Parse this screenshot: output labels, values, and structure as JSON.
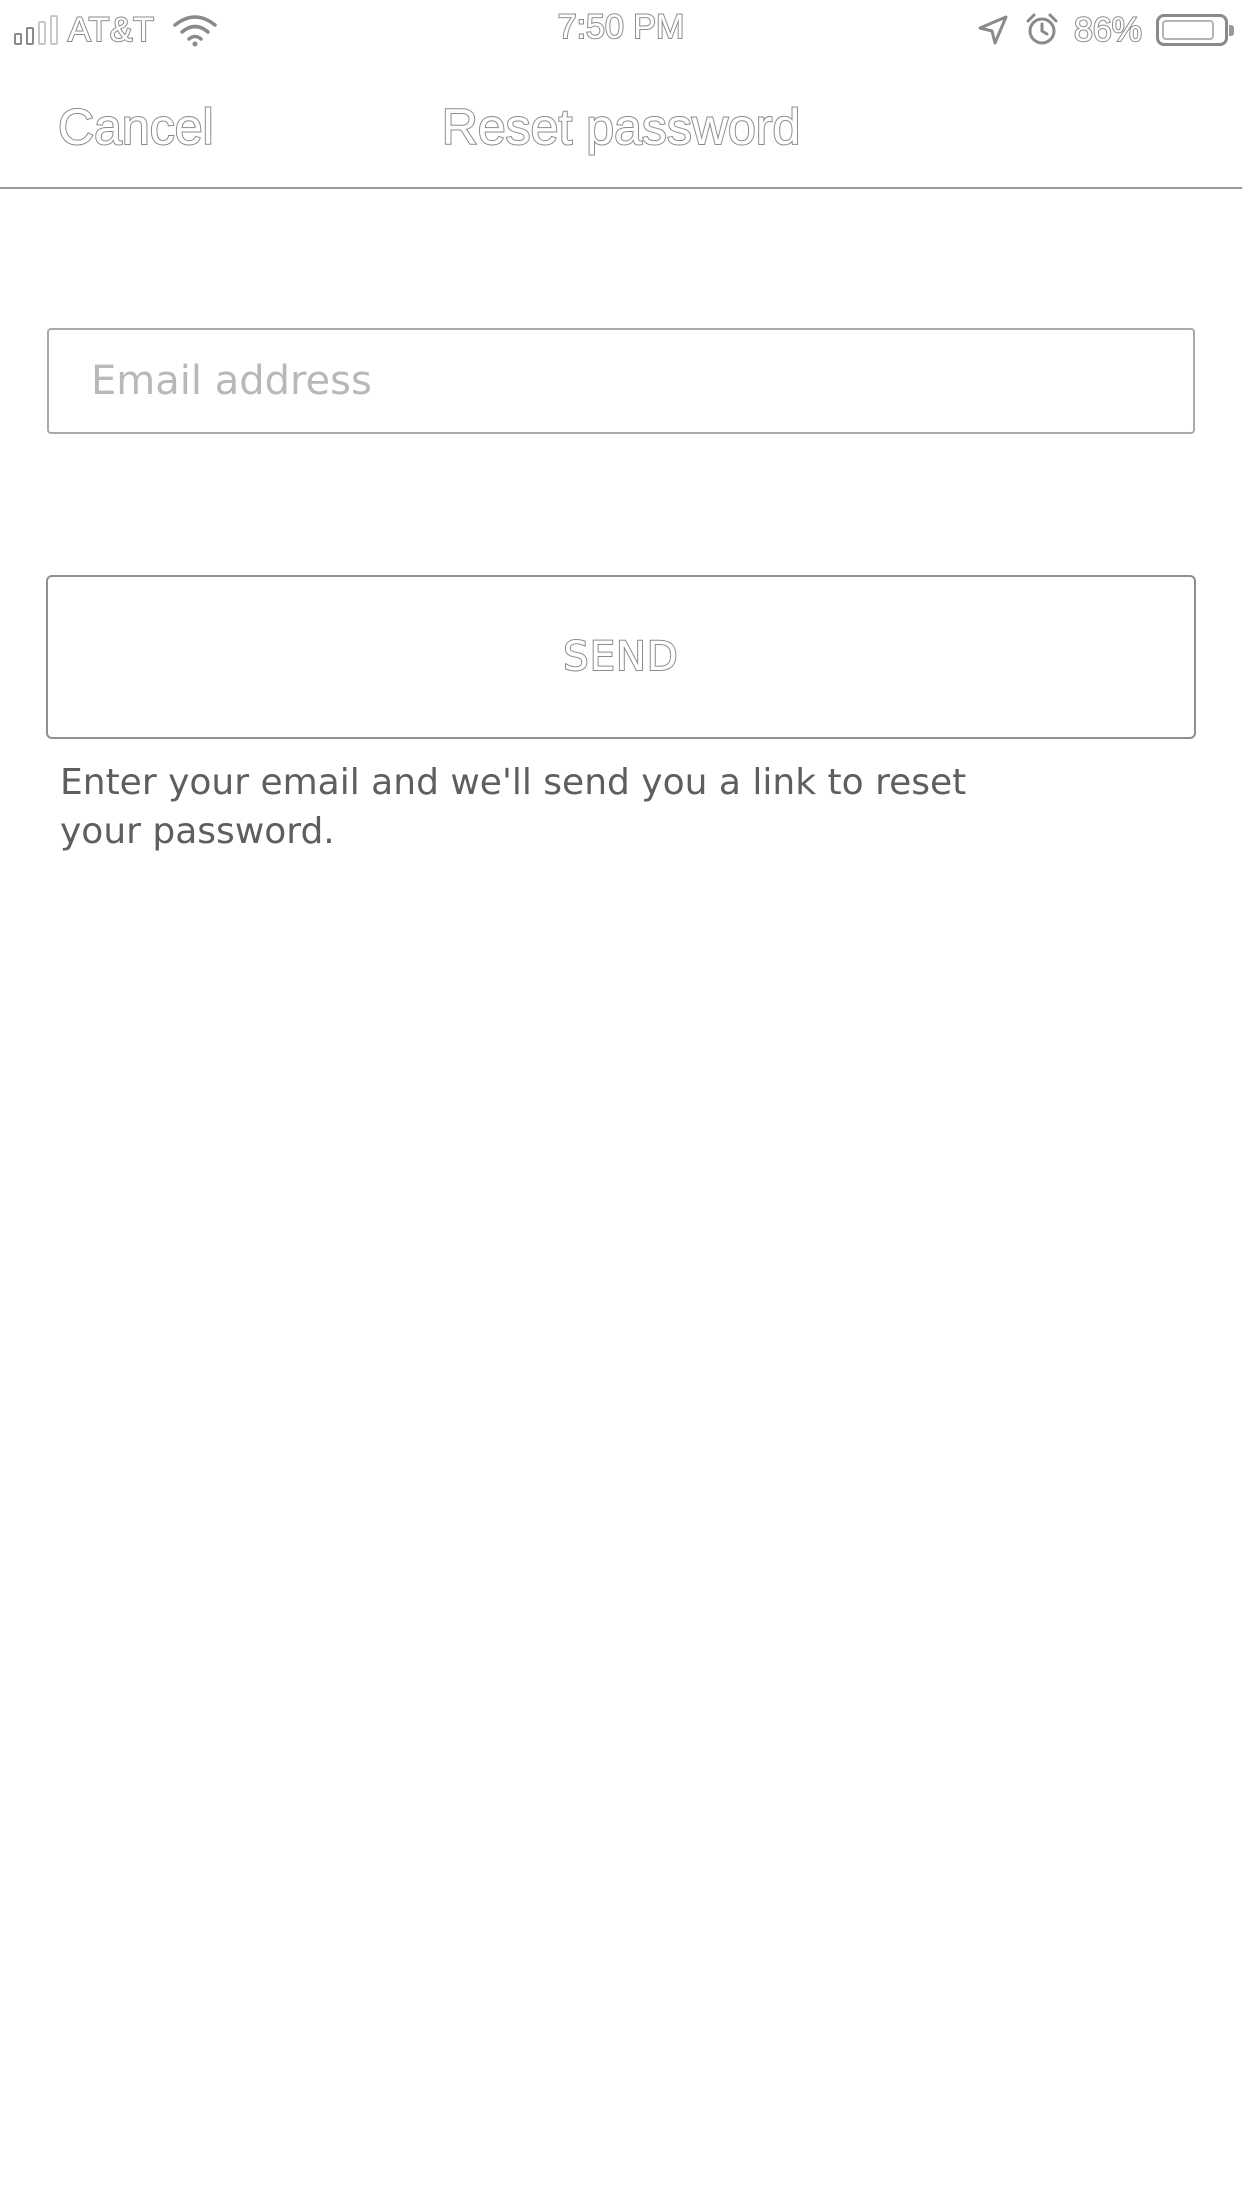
{
  "status_bar": {
    "carrier": "AT&T",
    "time": "7:50 PM",
    "battery_percent": "86%",
    "battery_level": 0.86,
    "signal_bars_filled": 2,
    "signal_bars_total": 4,
    "icons": [
      "signal-icon",
      "wifi-icon",
      "location-arrow-icon",
      "alarm-icon",
      "battery-icon"
    ]
  },
  "nav": {
    "cancel_label": "Cancel",
    "title": "Reset password"
  },
  "form": {
    "email_value": "",
    "email_placeholder": "Email address",
    "send_label": "SEND",
    "helper_text": "Enter your email and we'll send you a link to reset your password."
  },
  "colors": {
    "background": "#ffffff",
    "outline_text": "#8a8a8a",
    "border": "#a9a9a9",
    "placeholder": "#b8b8b8",
    "helper_text": "#5e5e5e"
  }
}
